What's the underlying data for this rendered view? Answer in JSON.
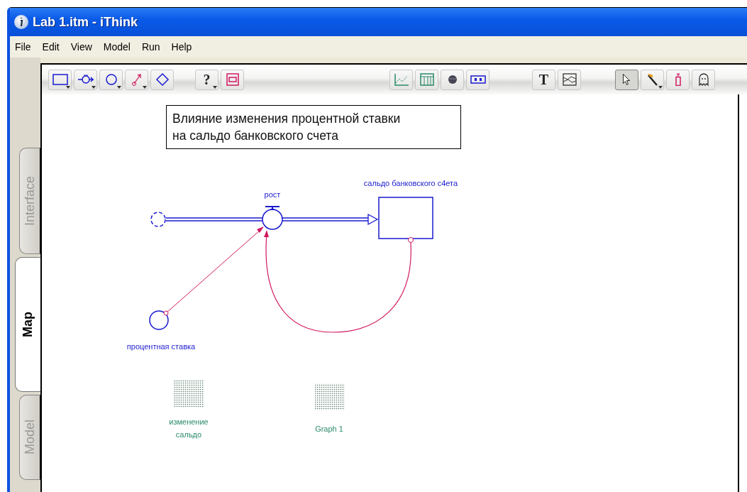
{
  "window": {
    "title": "Lab 1.itm - iThink"
  },
  "menu": [
    "File",
    "Edit",
    "View",
    "Model",
    "Run",
    "Help"
  ],
  "toolbar": [
    {
      "items": [
        {
          "kind": "stock",
          "dropdown": true,
          "selected": false
        },
        {
          "kind": "flow",
          "dropdown": true,
          "selected": false
        },
        {
          "kind": "converter",
          "dropdown": true,
          "selected": false
        },
        {
          "kind": "connector",
          "dropdown": true,
          "selected": false
        },
        {
          "kind": "decision",
          "dropdown": false,
          "selected": false
        }
      ]
    },
    {
      "items": [
        {
          "kind": "help",
          "label": "?",
          "dropdown": true,
          "selected": false
        },
        {
          "kind": "sector",
          "dropdown": false,
          "selected": false
        }
      ]
    },
    {
      "items": [
        {
          "kind": "graph",
          "dropdown": false,
          "selected": false
        },
        {
          "kind": "table",
          "dropdown": false,
          "selected": false
        },
        {
          "kind": "knob",
          "dropdown": false,
          "selected": false
        },
        {
          "kind": "numeric",
          "dropdown": false,
          "selected": false
        }
      ]
    },
    {
      "items": [
        {
          "kind": "text",
          "label": "T",
          "dropdown": false,
          "selected": false
        },
        {
          "kind": "picture",
          "dropdown": false,
          "selected": false
        }
      ]
    },
    {
      "items": [
        {
          "kind": "pointer",
          "dropdown": false,
          "selected": true
        },
        {
          "kind": "paintbrush",
          "dropdown": true,
          "selected": false
        },
        {
          "kind": "dynamite",
          "dropdown": false,
          "selected": false
        },
        {
          "kind": "ghost",
          "dropdown": false,
          "selected": false
        }
      ]
    }
  ],
  "tabs": [
    {
      "label": "Interface",
      "selected": false
    },
    {
      "label": "Map",
      "selected": true
    },
    {
      "label": "Model",
      "selected": false
    }
  ],
  "diagram": {
    "note": "Влияние изменения процентной ставки\nна сальдо банковского счета",
    "nodes": [
      {
        "kind": "cloud"
      },
      {
        "kind": "flow",
        "label": "рост"
      },
      {
        "kind": "stock",
        "label": "сальдо банковского с4ета"
      },
      {
        "kind": "converter",
        "label": "процентная ставка"
      },
      {
        "kind": "table",
        "label": "изменение сальдо"
      },
      {
        "kind": "graph",
        "label": "Graph 1"
      }
    ]
  }
}
